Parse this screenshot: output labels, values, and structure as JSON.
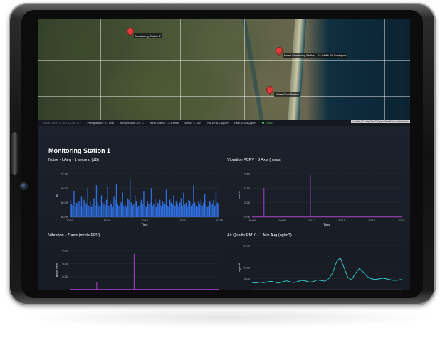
{
  "map": {
    "markers": [
      {
        "label": "Monitoring Station 2"
      },
      {
        "label": "Noise Monitoring Station - 24 Wolfe St, Southport"
      },
      {
        "label": "Noise Dust Station"
      }
    ],
    "attribution": "Leaflet | © MapTiler © OpenStreetMap contributors"
  },
  "status": {
    "section": "WEATHER & AIR QUALITY",
    "precipitation": "Precipitation: 0.1 mm",
    "temperature": "Temperature: 19°C",
    "wind_speed": "Wind Speed: 13.3 km/h",
    "wind_dir": "Wind: ↘ 152°",
    "pm10": "PM10: 6.2 µg/m³",
    "pm25": "PM2.5: 1.8 µg/m³",
    "air_status": "Good",
    "colors": {
      "good": "#4ccb5a",
      "marker": "#e23b3b"
    }
  },
  "station_title": "Monitoring Station 1",
  "chart_data": [
    {
      "type": "bar",
      "title": "Noise - LAeq - 1 second (dB)",
      "ylabel": "dB",
      "xlabel": "Time",
      "ylim": [
        40,
        70
      ],
      "y_ticks": [
        "70.00",
        "60.00",
        "50.00",
        "40.00"
      ],
      "x_ticks": [
        "10:00",
        "10:06",
        "10:12",
        "10:15",
        "10:18"
      ],
      "color": "#2f6fe0",
      "values": [
        52,
        49,
        48,
        58,
        47,
        50,
        49,
        51,
        48,
        54,
        47,
        52,
        50,
        49,
        60,
        48,
        51,
        47,
        49,
        53,
        48,
        62,
        50,
        48,
        47,
        55,
        50,
        49,
        48,
        52,
        61,
        48,
        50,
        49,
        47,
        54,
        52,
        63,
        49,
        48,
        51,
        50,
        57,
        48,
        49,
        47,
        53,
        52,
        66,
        50,
        48,
        49,
        55,
        51,
        47,
        48,
        50,
        52,
        49,
        58,
        48,
        47,
        51,
        49,
        50,
        60,
        48,
        49,
        53,
        47,
        50,
        49,
        52,
        48,
        51,
        50,
        49,
        59,
        48,
        47,
        52,
        50,
        49,
        55,
        48,
        51,
        49,
        47,
        50,
        53,
        48,
        57,
        49,
        50,
        47,
        52,
        51,
        48,
        49,
        62,
        50,
        48,
        47,
        51,
        49,
        52,
        48,
        50,
        56,
        49,
        47,
        48,
        51,
        50,
        49,
        52,
        48,
        58,
        50,
        49
      ]
    },
    {
      "type": "line",
      "title": "Vibration PCPV - 3 Axis (mm/s)",
      "ylabel": "mm/s",
      "xlabel": "Time",
      "ylim": [
        0,
        0.6
      ],
      "y_ticks": [
        "0.60",
        "0.40",
        "0.20",
        "0.00"
      ],
      "x_ticks": [
        "10:00",
        "10:06",
        "10:12",
        "10:15",
        "10:18",
        "10:21"
      ],
      "color": "#b13dd6",
      "spikes": [
        {
          "x": 0.08,
          "value": 0.4
        },
        {
          "x": 0.39,
          "value": 0.58
        }
      ]
    },
    {
      "type": "line",
      "title": "Vibration - Z axis (mm/s PPV)",
      "ylabel": "mm/s PPV",
      "xlabel": "",
      "ylim": [
        0,
        0.6
      ],
      "y_ticks": [
        "0.60",
        "0.40",
        "0.20"
      ],
      "x_ticks": [],
      "color": "#b13dd6",
      "spikes": [
        {
          "x": 0.18,
          "value": 0.12
        },
        {
          "x": 0.43,
          "value": 0.55
        }
      ]
    },
    {
      "type": "line",
      "title": "Air Quality PM10 - 1 Min Avg (ug/m3)",
      "ylabel": "ug/m3",
      "xlabel": "",
      "ylim": [
        0,
        20
      ],
      "y_ticks": [
        "20.00",
        "10.00",
        "5.00"
      ],
      "x_ticks": [],
      "color": "#2fc7c9",
      "values": [
        3.2,
        3.0,
        3.4,
        3.1,
        3.5,
        3.8,
        3.3,
        3.0,
        3.6,
        4.0,
        3.5,
        3.2,
        3.7,
        4.2,
        3.9,
        3.4,
        3.6,
        4.4,
        4.1,
        3.8,
        5.0,
        7.5,
        12.5,
        14.5,
        10.0,
        5.5,
        4.5,
        7.5,
        9.5,
        8.0,
        6.0,
        5.0,
        4.6,
        4.8,
        5.2,
        4.9,
        4.5,
        4.2,
        4.3,
        4.6
      ]
    }
  ]
}
